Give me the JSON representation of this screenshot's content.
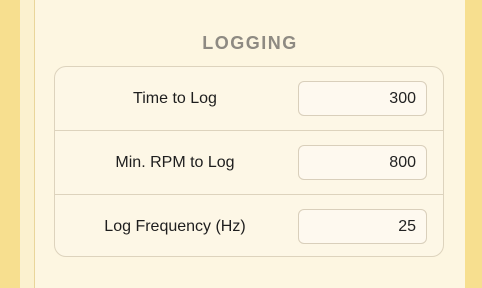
{
  "section": {
    "title": "LOGGING"
  },
  "settings": [
    {
      "label": "Time to Log",
      "value": "300"
    },
    {
      "label": "Min. RPM to Log",
      "value": "800"
    },
    {
      "label": "Log Frequency (Hz)",
      "value": "25"
    }
  ],
  "colors": {
    "edge_accent": "#f7df8f",
    "panel_background": "#fdf6e1",
    "title_text": "#8e8a82",
    "card_border": "#ddd3bd",
    "input_background": "#fef9ef"
  }
}
